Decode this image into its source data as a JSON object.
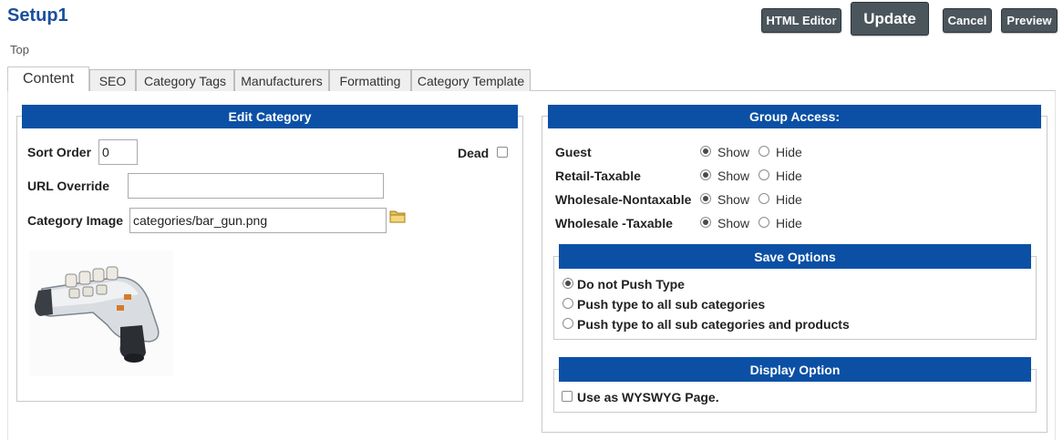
{
  "header": {
    "title": "Setup1",
    "breadcrumb": "Top",
    "buttons": {
      "html_editor": "HTML Editor",
      "update": "Update",
      "cancel": "Cancel",
      "preview": "Preview"
    }
  },
  "tabs": [
    {
      "label": "Content",
      "active": true
    },
    {
      "label": "SEO",
      "active": false
    },
    {
      "label": "Category Tags",
      "active": false
    },
    {
      "label": "Manufacturers",
      "active": false
    },
    {
      "label": "Formatting",
      "active": false
    },
    {
      "label": "Category Template",
      "active": false
    }
  ],
  "edit_category": {
    "heading": "Edit Category",
    "sort_order_label": "Sort Order",
    "sort_order_value": "0",
    "dead_label": "Dead",
    "dead_checked": false,
    "url_override_label": "URL Override",
    "url_override_value": "",
    "category_image_label": "Category Image",
    "category_image_value": "categories/bar_gun.png",
    "browse_icon": "folder-icon",
    "image_subject": "bar-gun-product-image"
  },
  "group_access": {
    "heading": "Group Access:",
    "show_label": "Show",
    "hide_label": "Hide",
    "groups": [
      {
        "name": "Guest",
        "selected": "Show"
      },
      {
        "name": "Retail-Taxable",
        "selected": "Show"
      },
      {
        "name": "Wholesale-Nontaxable",
        "selected": "Show"
      },
      {
        "name": "Wholesale -Taxable",
        "selected": "Show"
      }
    ]
  },
  "save_options": {
    "heading": "Save Options",
    "options": [
      {
        "label": "Do not Push Type",
        "selected": true
      },
      {
        "label": "Push type to all sub categories",
        "selected": false
      },
      {
        "label": "Push type to all sub categories and products",
        "selected": false
      }
    ]
  },
  "display_option": {
    "heading": "Display Option",
    "wysiwyg_label": "Use as WYSWYG Page.",
    "wysiwyg_checked": false
  },
  "colors": {
    "title": "#1a4f9c",
    "section_bar": "#0b50a5",
    "button": "#4b555c"
  }
}
